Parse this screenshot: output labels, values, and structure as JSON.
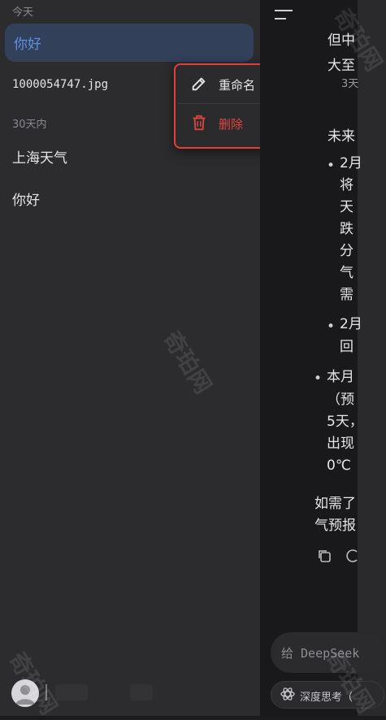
{
  "drawer": {
    "section_today": "今天",
    "section_30_days": "30天内",
    "items_today": [
      "你好",
      "1000054747.jpg"
    ],
    "items_30_days": [
      "上海天气",
      "你好"
    ]
  },
  "context_menu": {
    "rename_label": "重命名",
    "delete_label": "删除",
    "rename_icon": "pencil-icon",
    "delete_icon": "trash-icon",
    "highlight_color": "#e0403a",
    "delete_color": "#e0463e"
  },
  "chat_peek": {
    "lines": [
      "但中",
      "大至",
      "3天",
      "未来",
      "2月",
      "将",
      "天",
      "跌",
      "分",
      "气",
      "需",
      "2月",
      "回",
      "本月",
      "（预",
      "5天，",
      "出现",
      "0℃",
      "如需了",
      "气预报"
    ],
    "input_placeholder": "给 DeepSeek",
    "deep_think_label": "深度思考（"
  },
  "watermark_text": "奇珀网",
  "colors": {
    "accent_blue": "#5d91e6",
    "active_bg": "#33405a",
    "drawer_bg": "#2c2c2e"
  }
}
